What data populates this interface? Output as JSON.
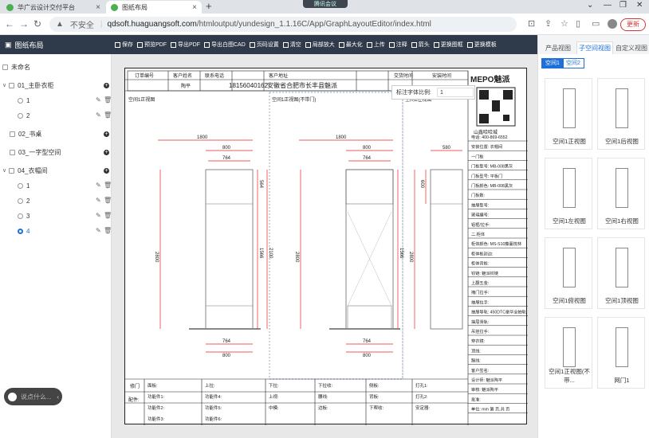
{
  "browser": {
    "tab1": "华广云设计交付平台",
    "tab2": "图纸布局",
    "new_tab": "+",
    "close": "×",
    "badge": "腾讯会议",
    "security": "不安全",
    "url_host": "qdsoft.huaguangsoft.com",
    "url_path": "/htmloutput/yundesign_1.1.16C/App/GraphLayoutEditor/index.html",
    "update": "更新"
  },
  "left": {
    "title": "图纸布局",
    "items": [
      {
        "label": "未命名"
      },
      {
        "label": "01_主卧衣柜"
      },
      {
        "label": "1"
      },
      {
        "label": "2"
      },
      {
        "label": "02_书桌"
      },
      {
        "label": "03_一字型空间"
      },
      {
        "label": "04_衣帽间"
      },
      {
        "label": "1"
      },
      {
        "label": "2"
      },
      {
        "label": "3"
      },
      {
        "label": "4"
      }
    ],
    "chat": "说点什么..."
  },
  "toolbar": {
    "items": [
      "保存",
      "预览PDF",
      "导出PDF",
      "导出白图CAD",
      "页码设置",
      "清空",
      "局部放大",
      "最大化",
      "上传",
      "注释",
      "箭头",
      "更换图框",
      "更换模板"
    ]
  },
  "right": {
    "tabs": [
      "产品视图",
      "子空间视图",
      "自定义视图"
    ],
    "space_buttons": [
      "空间1",
      "空间2"
    ],
    "views": [
      "空间1正视图",
      "空间1后视图",
      "空间1左视图",
      "空间1右视图",
      "空间1俯视图",
      "空间1顶视图",
      "空间1正视图(不带...",
      "网门1"
    ]
  },
  "scale": {
    "label": "标注字体比例:",
    "value": "1"
  },
  "sheet": {
    "header": [
      "订单编号",
      "客户姓名",
      "联系电话",
      "客户地址",
      "",
      "",
      "交货时间",
      "安装时间"
    ],
    "customer": "陶平",
    "phone": "18156040162",
    "address": "安徽省合肥市长丰县魅派",
    "view_titles": [
      "空间1正视图",
      "空间1正视图(不带门)",
      "空间1左视图"
    ],
    "dims": {
      "w1800": "1800",
      "w800": "800",
      "w764": "764",
      "h2800": "2800",
      "h2100": "2100",
      "d600": "600",
      "d564": "564",
      "d1566": "1566",
      "d400": "400",
      "d580": "580"
    },
    "brand": "MEPO魅派",
    "company": "山鑫哈哈城",
    "info": [
      "电话:  400-869-6552",
      "安装位置:  衣帽间",
      "一门板",
      "门板型号:  MB-008黑灰",
      "门板型号:  平板门",
      "门板颜色:  MB-008黑灰",
      "门板数:",
      "抽屉型号:",
      "玻璃编号:",
      "铝框/拉手:",
      "二.柜体",
      "柜体颜色: MS-S10藤蔓梳林",
      "柜体板封边:",
      "柜体背板:",
      "铰链: 魅派铰链",
      "上翻五金:",
      "掩门拉手:",
      "抽屉拉手:",
      "抽屉导轨: 450DTC豪华全抽轨",
      "抽屉滑轨:",
      "吊挂拉手:",
      "穿衣镜:",
      "顶线:",
      "踢线:",
      "客户签名:",
      "设计师: 魅派陶平",
      "审核: 魅派陶平",
      "批准:",
      "单位: mm  第  页,共  页"
    ],
    "footer_labels": [
      "修门",
      "配件:"
    ],
    "footer": [
      "面板:",
      "上拉:",
      "下拉:",
      "下拉收:",
      "侧板:",
      "打孔1:",
      "功能件1:",
      "功能件4:",
      "上视:",
      "腰线:",
      "背板:",
      "打孔2:",
      "功能件2:",
      "功能件5:",
      "中模:",
      "边板:",
      "下帮收:",
      "安定器:",
      "功能件3:",
      "功能件6:"
    ]
  }
}
